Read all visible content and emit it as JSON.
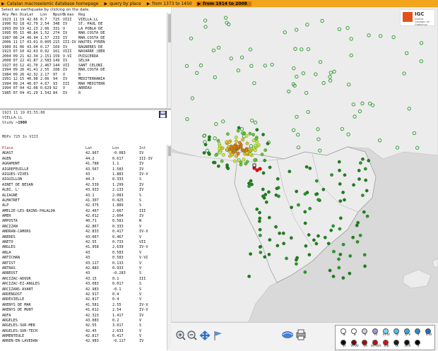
{
  "nav": [
    {
      "label": "Catalan macroseismic database homepage",
      "active": false
    },
    {
      "label": "query by place",
      "active": false
    },
    {
      "label": "from 1373 to 1450",
      "active": false
    },
    {
      "label": "from 1914 to 2008",
      "active": true
    }
  ],
  "subtitle": "Select an earthquake by clicking on the date.",
  "eq_header": {
    "date": "Any Mes Dia",
    "lat": "Lat",
    "lon": "Lon",
    "np": "Npunts",
    "int": "I max",
    "reg": "Reg"
  },
  "earthquakes": [
    {
      "date": "1923 11 19",
      "lat": "42.66",
      "lon": "0.7",
      "np": "725",
      "int": "VIII",
      "reg": "VIELLA.LL"
    },
    {
      "date": "1996 02 18",
      "lat": "42.79",
      "lon": "2.54",
      "np": "348",
      "int": "IV",
      "reg": "ST. PAUL DE"
    },
    {
      "date": "1993 09 19",
      "lat": "42.23",
      "lon": "2.06",
      "np": "331",
      "int": "V",
      "reg": "LA POBLA DE"
    },
    {
      "date": "1995 05 15",
      "lat": "40.84",
      "lon": "1.52",
      "np": "274",
      "int": "IV",
      "reg": "MAR.COSTA DE"
    },
    {
      "date": "1987 08 24",
      "lat": "40.94",
      "lon": "1.57",
      "np": "233",
      "int": "IV",
      "reg": "MAR.COSTA DE"
    },
    {
      "date": "2006 11 17",
      "lat": "43.01",
      "lon": "0.005",
      "np": "215",
      "int": "III-IV",
      "reg": "HAUTES PYREN"
    },
    {
      "date": "1989 01 06",
      "lat": "43.04",
      "lon": "0.17",
      "np": "169",
      "int": "IV",
      "reg": "BAGNERES DE"
    },
    {
      "date": "1923 07 10",
      "lat": "42.63",
      "lon": "0.92",
      "np": "161",
      "int": "VIII",
      "reg": "NAVARRE (BER"
    },
    {
      "date": "2004 09 21",
      "lat": "42.34",
      "lon": "2.151",
      "np": "159",
      "int": "V-VI",
      "reg": "PUIGCERDA"
    },
    {
      "date": "2008 07 22",
      "lat": "41.87",
      "lon": "2.583",
      "np": "149",
      "int": "IV",
      "reg": "SELVA"
    },
    {
      "date": "1927 03 12",
      "lat": "41.70",
      "lon": "2.467",
      "np": "144",
      "int": "VII",
      "reg": "SANT CELONI."
    },
    {
      "date": "1994 09 26",
      "lat": "41.41",
      "lon": "2.55",
      "np": "108",
      "int": "IV",
      "reg": "MAR.COSTA DE"
    },
    {
      "date": "1984 09 26",
      "lat": "42.32",
      "lon": "2.17",
      "np": "97",
      "int": "V",
      "reg": "0"
    },
    {
      "date": "1991 12 15",
      "lat": "40.98",
      "lon": "2.06",
      "np": "94",
      "int": "IV",
      "reg": "MEDITERRANIA"
    },
    {
      "date": "1994 09 24",
      "lat": "40.97",
      "lon": "4.67",
      "np": "93",
      "int": "III",
      "reg": "MAR MEDITERR"
    },
    {
      "date": "1994 07 04",
      "lat": "42.08",
      "lon": "0.629",
      "np": "92",
      "int": "V",
      "reg": "ARREAU"
    },
    {
      "date": "1985 07 04",
      "lat": "41.29",
      "lon": "1.542",
      "np": "84",
      "int": "IV",
      "reg": "0"
    }
  ],
  "selected": {
    "datetime": "1923 11 19 03:55:00",
    "place": "VIELLA.LL",
    "study": "Study >",
    "study_val": "1980",
    "mdps": "MDPs 725   Io VIII"
  },
  "places_header": {
    "place": "Place",
    "lat": "Lat",
    "lon": "Lon",
    "int": "Int"
  },
  "places": [
    {
      "n": "ADAST",
      "lat": "42.967",
      "lon": "-0.083",
      "i": "IV"
    },
    {
      "n": "AGEN",
      "lat": "44.2",
      "lon": "0.617",
      "i": "III-IV"
    },
    {
      "n": "AGRAMUNT",
      "lat": "41.788",
      "lon": "1.1",
      "i": "IV"
    },
    {
      "n": "AIGREFEUILLE",
      "lat": "43.567",
      "lon": "1.583",
      "i": "IV"
    },
    {
      "n": "AIGUES-VIVES",
      "lat": "43",
      "lon": "1.883",
      "i": "IV-V"
    },
    {
      "n": "AIGUILLON",
      "lat": "44.3",
      "lon": "0.333",
      "i": "S"
    },
    {
      "n": "AINET DE BESAN",
      "lat": "42.539",
      "lon": "1.299",
      "i": "IV"
    },
    {
      "n": "ALBI, L'",
      "lat": "43.933",
      "lon": "2.133",
      "i": "IV"
    },
    {
      "n": "ALIAGNE",
      "lat": "43.1",
      "lon": "2.083",
      "i": "S"
    },
    {
      "n": "ALMATRET",
      "lat": "41.307",
      "lon": "0.425",
      "i": "S"
    },
    {
      "n": "ALP",
      "lat": "42.375",
      "lon": "1.889",
      "i": "S"
    },
    {
      "n": "AMELIE-LES-BAINS-PALALDA",
      "lat": "42.467",
      "lon": "2.667",
      "i": "III"
    },
    {
      "n": "AMER",
      "lat": "42.012",
      "lon": "2.604",
      "i": "IV"
    },
    {
      "n": "AMPOSTA",
      "lat": "40.71",
      "lon": "0.581",
      "i": "N"
    },
    {
      "n": "ANCIZAN",
      "lat": "42.867",
      "lon": "0.333",
      "i": "V"
    },
    {
      "n": "ANDRAN-CAMORS",
      "lat": "42.833",
      "lon": "0.417",
      "i": "IV-V"
    },
    {
      "n": "ANERES",
      "lat": "43.067",
      "lon": "0.467",
      "i": "V"
    },
    {
      "n": "ANETO",
      "lat": "42.55",
      "lon": "0.733",
      "i": "VII"
    },
    {
      "n": "ANGLES",
      "lat": "41.958",
      "lon": "2.639",
      "i": "IV-V"
    },
    {
      "n": "ANLA",
      "lat": "43",
      "lon": "0.583",
      "i": "V"
    },
    {
      "n": "ANTICHAN",
      "lat": "43",
      "lon": "0.583",
      "i": "V-VI"
    },
    {
      "n": "ANTIST",
      "lat": "43.117",
      "lon": "0.133",
      "i": "V"
    },
    {
      "n": "ANTRAS",
      "lat": "42.883",
      "lon": "0.933",
      "i": "V"
    },
    {
      "n": "ARBEOST",
      "lat": "43",
      "lon": "-0.283",
      "i": "S"
    },
    {
      "n": "ARCIZAC-ADOUR",
      "lat": "43.15",
      "lon": "0.1",
      "i": "III"
    },
    {
      "n": "ARCIZAC-EZ-ANGLES",
      "lat": "43.083",
      "lon": "0.017",
      "i": "S"
    },
    {
      "n": "ARCIZANS-AVANT",
      "lat": "42.983",
      "lon": "-0.1",
      "i": "S"
    },
    {
      "n": "ARDENGOST",
      "lat": "42.917",
      "lon": "0.4",
      "i": "V"
    },
    {
      "n": "ARDEVIELLE",
      "lat": "42.817",
      "lon": "0.4",
      "i": "V"
    },
    {
      "n": "ARENYS DE MAR",
      "lat": "41.581",
      "lon": "2.55",
      "i": "IV-V"
    },
    {
      "n": "ARENYS DE MUNT",
      "lat": "41.612",
      "lon": "2.54",
      "i": "IV-V"
    },
    {
      "n": "ARFA",
      "lat": "42.323",
      "lon": "1.417",
      "i": "IV"
    },
    {
      "n": "ARGELES",
      "lat": "43.083",
      "lon": "0.2",
      "i": "V"
    },
    {
      "n": "ARGELES-SUR-MER",
      "lat": "42.55",
      "lon": "3.017",
      "i": "S"
    },
    {
      "n": "ARGELES-SUR-TECH",
      "lat": "42.45",
      "lon": "2.633",
      "i": "V"
    },
    {
      "n": "ARMENTEULE",
      "lat": "42.817",
      "lon": "0.417",
      "i": "V"
    },
    {
      "n": "ARREN-EN-LAVEDAN",
      "lat": "42.983",
      "lon": "-0.117",
      "i": "IV"
    }
  ],
  "map": {
    "sea_color": "#d9d9d9",
    "land_color": "#ececec",
    "logo": "IGC",
    "logo_sub": "Institut Geològic de Catalunya"
  },
  "legend": [
    {
      "label": "N",
      "color": "#ffffff"
    },
    {
      "label": "S",
      "color": "#ffffff"
    },
    {
      "label": "II",
      "color": "#cfcfef"
    },
    {
      "label": "III",
      "color": "#9a9ae0"
    },
    {
      "label": "III-IV",
      "color": "#7fd6ff"
    },
    {
      "label": "IV",
      "color": "#4fc0ff"
    },
    {
      "label": "IV-V",
      "color": "#33aadd"
    },
    {
      "label": "V",
      "color": "#2a8ccc"
    },
    {
      "label": "V-VI",
      "color": "#1f6fbf"
    },
    {
      "label": "VI",
      "color": "#0d0d0d"
    },
    {
      "label": "VI-VII",
      "color": "#6a0a0a"
    },
    {
      "label": "VII",
      "color": "#a40d0d"
    },
    {
      "label": "VII-VIII",
      "color": "#c40d0d"
    },
    {
      "label": "VIII",
      "color": "#e01010"
    },
    {
      "label": "IX",
      "color": "#1a1a1a"
    },
    {
      "label": "IX-X",
      "color": "#111111"
    },
    {
      "label": "X",
      "color": "#000000"
    }
  ],
  "icons": [
    "zoom-in-icon",
    "zoom-out-icon",
    "pan-icon",
    "flag-icon",
    "printer-icon",
    "save-icon"
  ]
}
